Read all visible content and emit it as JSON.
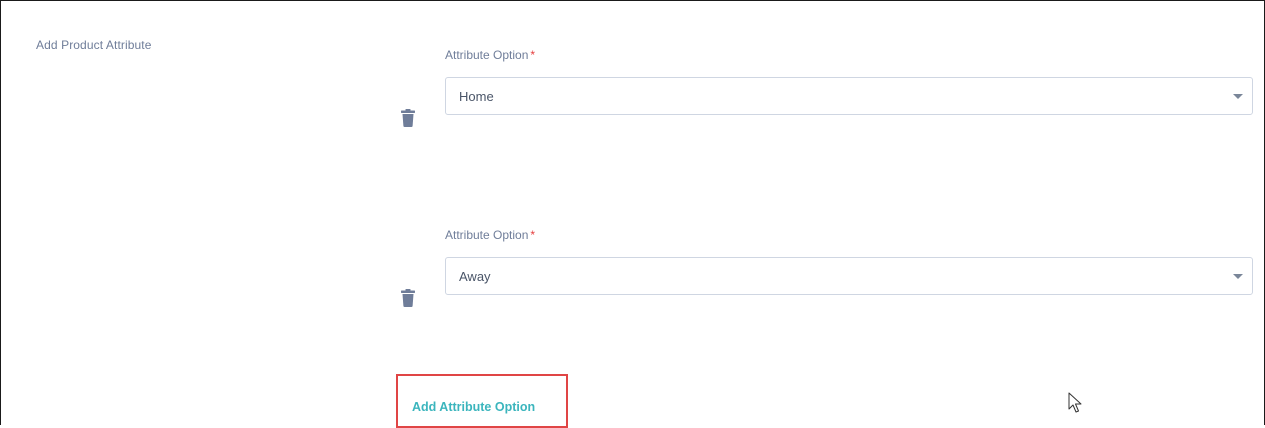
{
  "section": {
    "title": "Add Product Attribute"
  },
  "options": [
    {
      "label": "Attribute Option",
      "required_marker": "*",
      "selected_value": "Home",
      "delete_icon": "trash-icon",
      "dropdown_icon": "caret-down-icon"
    },
    {
      "label": "Attribute Option",
      "required_marker": "*",
      "selected_value": "Away",
      "delete_icon": "trash-icon",
      "dropdown_icon": "caret-down-icon"
    }
  ],
  "add_button": {
    "label": "Add Attribute Option"
  },
  "colors": {
    "label_text": "#6f7d99",
    "required": "#e53e3e",
    "input_border": "#cfd6e2",
    "link_accent": "#3bb5bd",
    "highlight_box": "#e04545",
    "icon": "#6f7d99"
  },
  "cursor": {
    "icon": "mouse-pointer-icon"
  }
}
